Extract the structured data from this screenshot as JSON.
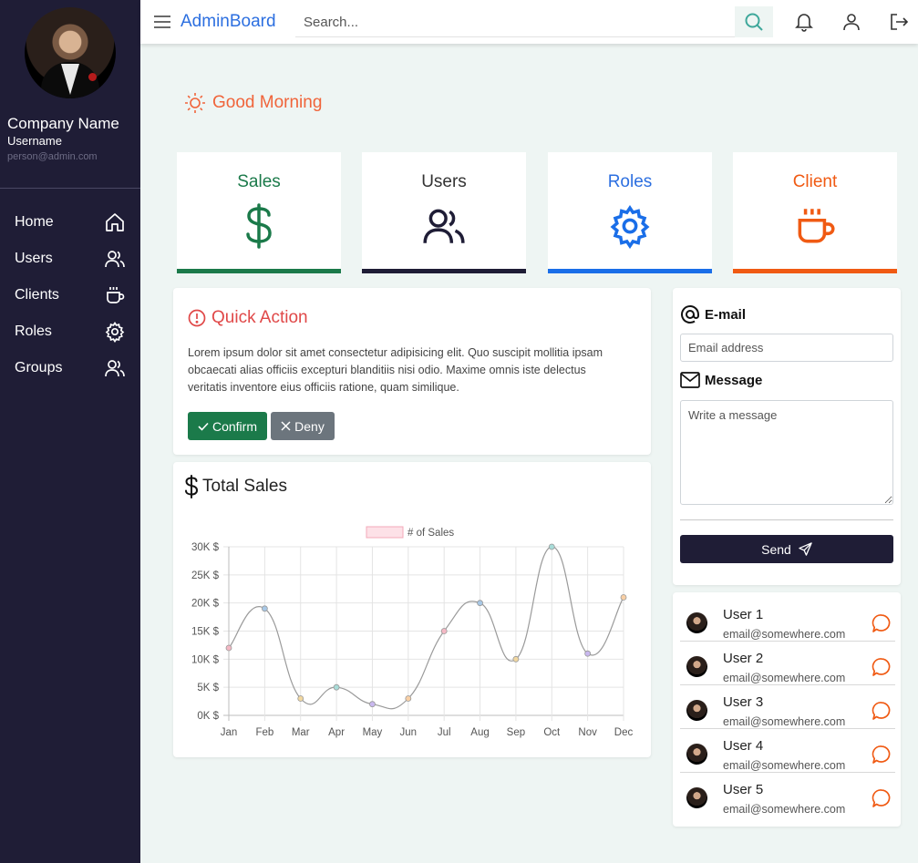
{
  "sidebar": {
    "company": "Company Name",
    "username": "Username",
    "email": "person@admin.com",
    "items": [
      {
        "label": "Home",
        "icon": "home-icon"
      },
      {
        "label": "Users",
        "icon": "users-icon"
      },
      {
        "label": "Clients",
        "icon": "cup-icon"
      },
      {
        "label": "Roles",
        "icon": "gear-icon"
      },
      {
        "label": "Groups",
        "icon": "users-icon"
      }
    ]
  },
  "header": {
    "brand": "AdminBoard",
    "search_placeholder": "Search..."
  },
  "greeting": "Good Morning",
  "cards": [
    {
      "title": "Sales",
      "icon": "dollar-icon",
      "color": "#1b7a4a"
    },
    {
      "title": "Users",
      "icon": "users-icon",
      "color": "#1f1d36"
    },
    {
      "title": "Roles",
      "icon": "gear-icon",
      "color": "#1a6ee8"
    },
    {
      "title": "Client",
      "icon": "cup-icon",
      "color": "#f05a13"
    }
  ],
  "quick_action": {
    "title": "Quick Action",
    "text": "Lorem ipsum dolor sit amet consectetur adipisicing elit. Quo suscipit mollitia ipsam obcaecati alias officiis excepturi blanditiis nisi odio. Maxime omnis iste delectus veritatis inventore eius officiis ratione, quam similique.",
    "confirm_label": "Confirm",
    "deny_label": "Deny"
  },
  "total_sales": {
    "title": "Total Sales"
  },
  "chart_data": {
    "type": "line",
    "categories": [
      "Jan",
      "Feb",
      "Mar",
      "Apr",
      "May",
      "Jun",
      "Jul",
      "Aug",
      "Sep",
      "Oct",
      "Nov",
      "Dec"
    ],
    "series": [
      {
        "name": "# of Sales",
        "values": [
          12000,
          19000,
          3000,
          5000,
          2000,
          3000,
          15000,
          20000,
          10000,
          30000,
          11000,
          21000
        ]
      }
    ],
    "y_ticks": [
      "30K $",
      "25K $",
      "20K $",
      "15K $",
      "10K $",
      "5K $",
      "0K $"
    ],
    "ylim": [
      0,
      30000
    ],
    "grid": true,
    "legend": "top"
  },
  "message_form": {
    "email_label": "E-mail",
    "email_placeholder": "Email address",
    "message_label": "Message",
    "message_placeholder": "Write a message",
    "send_label": "Send"
  },
  "users": [
    {
      "name": "User 1",
      "email": "email@somewhere.com"
    },
    {
      "name": "User 2",
      "email": "email@somewhere.com"
    },
    {
      "name": "User 3",
      "email": "email@somewhere.com"
    },
    {
      "name": "User 4",
      "email": "email@somewhere.com"
    },
    {
      "name": "User 5",
      "email": "email@somewhere.com"
    }
  ],
  "colors": {
    "sidebar_bg": "#1f1d36",
    "brand": "#2c6fe0",
    "greeting": "#f0643a",
    "confirm": "#1b7a4a",
    "deny": "#6c757d",
    "alert": "#e04848",
    "chat": "#f05a13"
  }
}
